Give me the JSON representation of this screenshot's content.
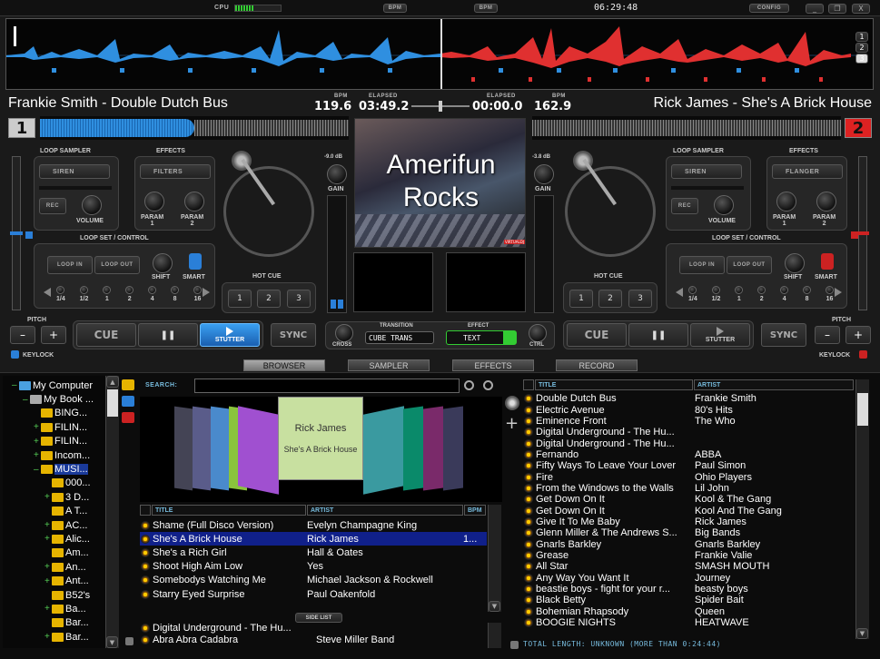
{
  "topbar": {
    "cpu_label": "CPU",
    "bpm_btn_1": "BPM",
    "bpm_btn_2": "BPM",
    "clock": "06:29:48",
    "config": "CONFIG",
    "win_min": "_",
    "win_max": "❐",
    "win_close": "X"
  },
  "overview": {
    "deck_nums": [
      "1",
      "2",
      "3"
    ]
  },
  "deck_left": {
    "title": "Frankie Smith - Double Dutch Bus",
    "bpm_label": "BPM",
    "bpm": "119.6",
    "elapsed_label": "ELAPSED",
    "elapsed": "03:49.2",
    "deck_num": "1",
    "loop_sampler": "LOOP SAMPLER",
    "sampler_select": "SIREN",
    "rec": "REC",
    "volume": "VOLUME",
    "effects": "EFFECTS",
    "effect_select": "FILTERS",
    "param1": "PARAM\n1",
    "param2": "PARAM\n2",
    "loop_set": "LOOP SET / CONTROL",
    "loop_in": "LOOP IN",
    "loop_out": "LOOP OUT",
    "shift": "SHIFT",
    "smart": "SMART",
    "loop_sizes": [
      "1/4",
      "1/2",
      "1",
      "2",
      "4",
      "8",
      "16"
    ],
    "gain_db": "-9.0 dB",
    "gain": "GAIN",
    "hot_cue": "HOT CUE",
    "hot_cues": [
      "1",
      "2",
      "3"
    ],
    "pitch": "PITCH",
    "minus": "–",
    "plus": "+",
    "keylock": "KEYLOCK",
    "cue": "CUE",
    "pause": "❚❚",
    "stutter": "STUTTER",
    "sync": "SYNC"
  },
  "deck_right": {
    "title": "Rick James - She's A Brick House",
    "bpm_label": "BPM",
    "bpm": "162.9",
    "elapsed_label": "ELAPSED",
    "elapsed": "00:00.0",
    "deck_num": "2",
    "loop_sampler": "LOOP SAMPLER",
    "sampler_select": "SIREN",
    "rec": "REC",
    "volume": "VOLUME",
    "effects": "EFFECTS",
    "effect_select": "FLANGER",
    "param1": "PARAM\n1",
    "param2": "PARAM\n2",
    "loop_set": "LOOP SET / CONTROL",
    "loop_in": "LOOP IN",
    "loop_out": "LOOP OUT",
    "shift": "SHIFT",
    "smart": "SMART",
    "loop_sizes": [
      "1/4",
      "1/2",
      "1",
      "2",
      "4",
      "8",
      "16"
    ],
    "gain_db": "-3.8 dB",
    "gain": "GAIN",
    "hot_cue": "HOT CUE",
    "hot_cues": [
      "1",
      "2",
      "3"
    ],
    "pitch": "PITCH",
    "minus": "–",
    "plus": "+",
    "keylock": "KEYLOCK",
    "cue": "CUE",
    "pause": "❚❚",
    "stutter": "STUTTER",
    "sync": "SYNC"
  },
  "mixer": {
    "video_line1": "Amerifun",
    "video_line2": "Rocks",
    "video_badge": "VIRTUALDJ",
    "transition_label": "TRANSITION",
    "transition_value": "CUBE TRANS",
    "effect_label": "EFFECT",
    "effect_value": "TEXT",
    "cross": "CROSS",
    "ctrl": "CTRL"
  },
  "tabs": [
    "BROWSER",
    "SAMPLER",
    "EFFECTS",
    "RECORD"
  ],
  "tree": [
    {
      "label": "My Computer",
      "indent": 0,
      "sign": "–"
    },
    {
      "label": "My Book ...",
      "indent": 1,
      "sign": "–"
    },
    {
      "label": "BING...",
      "indent": 2,
      "sign": ""
    },
    {
      "label": "FILIN...",
      "indent": 2,
      "sign": "+"
    },
    {
      "label": "FILIN...",
      "indent": 2,
      "sign": "+"
    },
    {
      "label": "Incom...",
      "indent": 2,
      "sign": "+"
    },
    {
      "label": "MUSI...",
      "indent": 2,
      "sign": "–",
      "selected": true
    },
    {
      "label": "000...",
      "indent": 3,
      "sign": ""
    },
    {
      "label": "3 D...",
      "indent": 3,
      "sign": "+"
    },
    {
      "label": "A T...",
      "indent": 3,
      "sign": ""
    },
    {
      "label": "AC...",
      "indent": 3,
      "sign": "+"
    },
    {
      "label": "Alic...",
      "indent": 3,
      "sign": "+"
    },
    {
      "label": "Am...",
      "indent": 3,
      "sign": ""
    },
    {
      "label": "An...",
      "indent": 3,
      "sign": "+"
    },
    {
      "label": "Ant...",
      "indent": 3,
      "sign": "+"
    },
    {
      "label": "B52's",
      "indent": 3,
      "sign": ""
    },
    {
      "label": "Ba...",
      "indent": 3,
      "sign": "+"
    },
    {
      "label": "Bar...",
      "indent": 3,
      "sign": ""
    },
    {
      "label": "Bar...",
      "indent": 3,
      "sign": "+"
    }
  ],
  "search": {
    "label": "SEARCH:",
    "value": ""
  },
  "coverflow": {
    "center_artist": "Rick James",
    "center_title": "She's A Brick House"
  },
  "mid_list": {
    "headers": [
      "TITLE",
      "ARTIST",
      "BPM"
    ],
    "rows": [
      {
        "title": "Shame (Full Disco Version)",
        "artist": "Evelyn Champagne King",
        "bpm": ""
      },
      {
        "title": "She's A Brick House",
        "artist": "Rick James",
        "bpm": "1...",
        "selected": true
      },
      {
        "title": "She's a Rich Girl",
        "artist": "Hall & Oates",
        "bpm": ""
      },
      {
        "title": "Shoot High Aim Low",
        "artist": "Yes",
        "bpm": ""
      },
      {
        "title": "Somebodys Watching Me",
        "artist": "Michael Jackson & Rockwell",
        "bpm": ""
      },
      {
        "title": "Starry Eyed Surprise",
        "artist": "Paul Oakenfold",
        "bpm": ""
      }
    ]
  },
  "side_list": {
    "label": "SIDE LIST",
    "rows": [
      {
        "title": "Digital Underground - The Hu...",
        "artist": ""
      },
      {
        "title": "Abra Abra Cadabra",
        "artist": "Steve Miller Band"
      }
    ]
  },
  "right_list": {
    "headers": [
      "TITLE",
      "ARTIST"
    ],
    "rows": [
      {
        "title": "Double Dutch Bus",
        "artist": "Frankie Smith"
      },
      {
        "title": "Electric Avenue",
        "artist": "80's Hits"
      },
      {
        "title": "Eminence Front",
        "artist": "The Who"
      },
      {
        "title": "Digital Underground - The Hu...",
        "artist": ""
      },
      {
        "title": "Digital Underground - The Hu...",
        "artist": ""
      },
      {
        "title": "Fernando",
        "artist": "ABBA"
      },
      {
        "title": "Fifty Ways To Leave Your Lover",
        "artist": "Paul Simon"
      },
      {
        "title": "Fire",
        "artist": "Ohio Players"
      },
      {
        "title": "From the Windows to the Walls",
        "artist": "Lil John"
      },
      {
        "title": "Get Down On It",
        "artist": "Kool & The Gang"
      },
      {
        "title": "Get Down On It",
        "artist": "Kool And The Gang"
      },
      {
        "title": "Give It To Me Baby",
        "artist": "Rick James"
      },
      {
        "title": "Glenn Miller & The Andrews S...",
        "artist": "Big Bands"
      },
      {
        "title": "Gnarls Barkley",
        "artist": "Gnarls Barkley"
      },
      {
        "title": "Grease",
        "artist": "Frankie Valie"
      },
      {
        "title": "All Star",
        "artist": "SMASH MOUTH"
      },
      {
        "title": "Any Way You Want It",
        "artist": "Journey"
      },
      {
        "title": "beastie boys - fight for your r...",
        "artist": "beasty boys"
      },
      {
        "title": "Black Betty",
        "artist": "Spider Bait"
      },
      {
        "title": "Bohemian Rhapsody",
        "artist": "Queen"
      },
      {
        "title": "BOOGIE NIGHTS",
        "artist": "HEATWAVE"
      }
    ]
  },
  "status": {
    "total_length": "TOTAL LENGTH: UNKNOWN (MORE THAN 0:24:44)"
  },
  "colors": {
    "left_wave": "#2f8fe0",
    "right_wave": "#e03030",
    "accent": "#2a7fd8",
    "green": "#3c3"
  }
}
